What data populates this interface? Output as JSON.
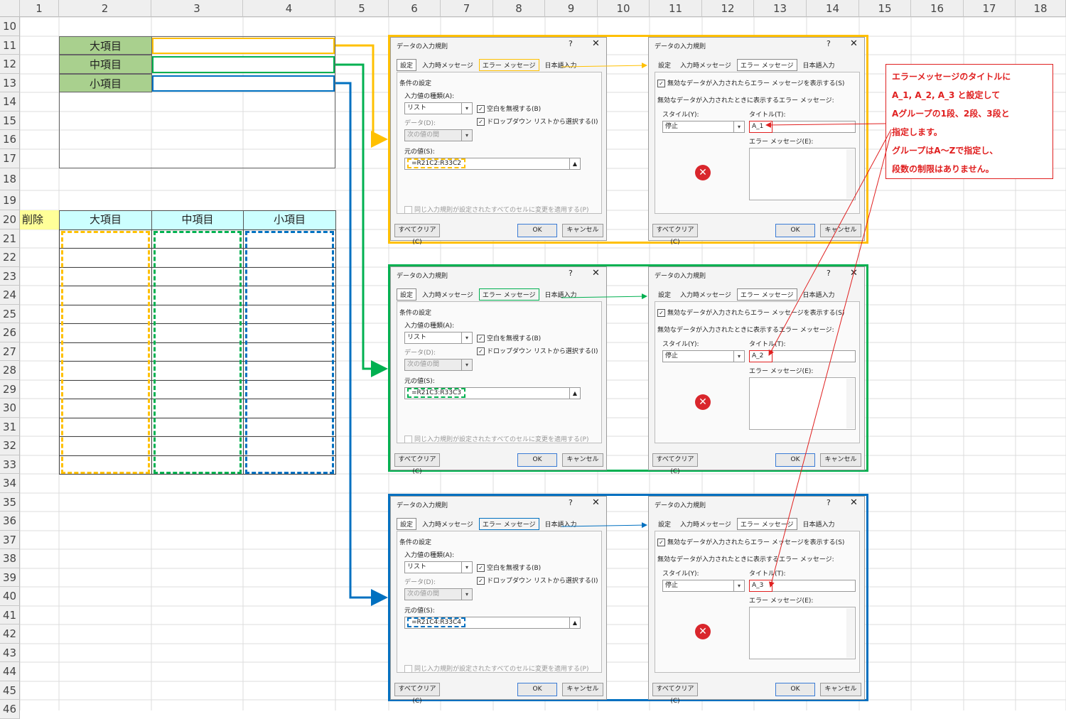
{
  "columns": [
    "1",
    "2",
    "3",
    "4",
    "5",
    "6",
    "7",
    "8",
    "9",
    "10",
    "11",
    "12",
    "13",
    "14",
    "15",
    "16",
    "17",
    "18"
  ],
  "rows": [
    "10",
    "11",
    "12",
    "13",
    "14",
    "15",
    "16",
    "17",
    "18",
    "19",
    "20",
    "21",
    "22",
    "23",
    "24",
    "25",
    "26",
    "27",
    "28",
    "29",
    "30",
    "31",
    "32",
    "33",
    "34",
    "35",
    "36",
    "37",
    "38",
    "39",
    "40",
    "41",
    "42",
    "43",
    "44",
    "45",
    "46"
  ],
  "labels": {
    "dai": "大項目",
    "chu": "中項目",
    "sho": "小項目"
  },
  "sakujo": "削除",
  "table_headers": [
    "大項目",
    "中項目",
    "小項目"
  ],
  "colors": {
    "yellow": "#ffc000",
    "green": "#00b050",
    "blue": "#0070c0",
    "red": "#e02020"
  },
  "dialog": {
    "title": "データの入力規則",
    "help": "?",
    "close": "✕",
    "tabs": [
      "設定",
      "入力時メッセージ",
      "エラー メッセージ",
      "日本語入力"
    ],
    "conditions": "条件の設定",
    "allow_label": "入力値の種類(A):",
    "allow_value": "リスト",
    "ignore_blank": "空白を無視する(B)",
    "dropdown": "ドロップダウン リストから選択する(I)",
    "data_label": "データ(D):",
    "data_value": "次の値の間",
    "source_label": "元の値(S):",
    "apply_all": "同じ入力規則が設定されたすべてのセルに変更を適用する(P)",
    "clear_all": "すべてクリア(C)",
    "ok": "OK",
    "cancel": "キャンセル",
    "show_error": "無効なデータが入力されたらエラー メッセージを表示する(S)",
    "when_invalid": "無効なデータが入力されたときに表示するエラー メッセージ:",
    "style_label": "スタイル(Y):",
    "style_value": "停止",
    "title_label": "タイトル(T):",
    "errmsg_label": "エラー メッセージ(E):",
    "error_icon": "✕"
  },
  "groups": [
    {
      "source": "=R21C2:R33C2",
      "title": "A_1"
    },
    {
      "source": "=R21C3:R33C3",
      "title": "A_2"
    },
    {
      "source": "=R21C4:R33C4",
      "title": "A_3"
    }
  ],
  "note_lines": [
    "エラーメッセージのタイトルに",
    "A_1, A_2, A_3 と設定して",
    "Aグループの1段、2段、3段と",
    "指定します。",
    "グループはA～Zで指定し、",
    "段数の制限はありません。"
  ]
}
